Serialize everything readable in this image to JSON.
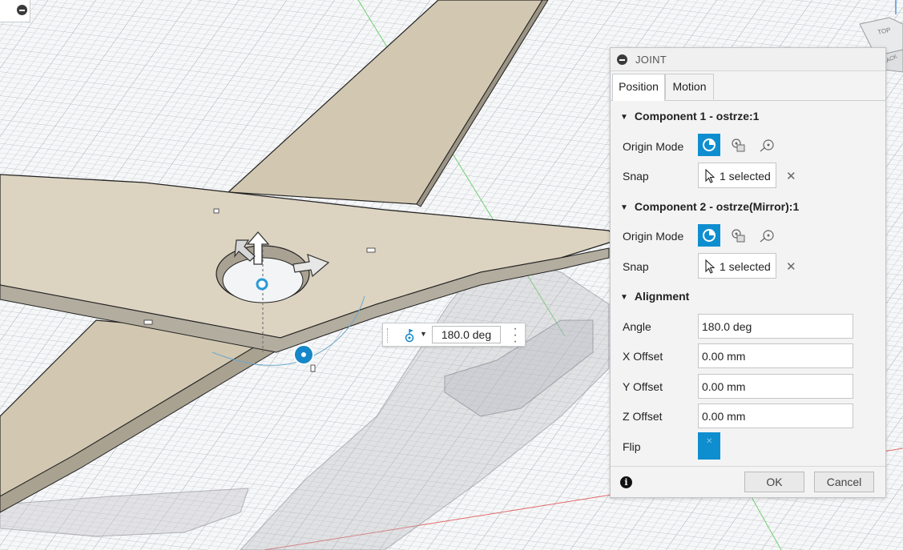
{
  "float_input": {
    "value": "180.0 deg"
  },
  "panel": {
    "title": "JOINT",
    "tabs": [
      {
        "label": "Position",
        "active": true
      },
      {
        "label": "Motion",
        "active": false
      }
    ],
    "component1": {
      "heading": "Component 1 - ostrze:1",
      "origin_mode_label": "Origin Mode",
      "snap_label": "Snap",
      "snap_value": "1 selected"
    },
    "component2": {
      "heading": "Component 2 - ostrze(Mirror):1",
      "origin_mode_label": "Origin Mode",
      "snap_label": "Snap",
      "snap_value": "1 selected"
    },
    "alignment": {
      "heading": "Alignment",
      "angle_label": "Angle",
      "angle_value": "180.0 deg",
      "x_offset_label": "X Offset",
      "x_offset_value": "0.00 mm",
      "y_offset_label": "Y Offset",
      "y_offset_value": "0.00 mm",
      "z_offset_label": "Z Offset",
      "z_offset_value": "0.00 mm",
      "flip_label": "Flip"
    },
    "footer": {
      "ok_label": "OK",
      "cancel_label": "Cancel"
    }
  },
  "colors": {
    "accent": "#0f8ecf",
    "blade_fill": "#d9d0bd",
    "blade_side": "#b9b2a2",
    "grid": "#c4c9ce"
  },
  "icons": [
    "minus-circle-icon",
    "origin-simple-icon",
    "origin-between-icon",
    "origin-two-faces-icon",
    "cursor-icon",
    "close-icon",
    "info-icon",
    "joint-origin-icon",
    "more-vertical-icon"
  ]
}
